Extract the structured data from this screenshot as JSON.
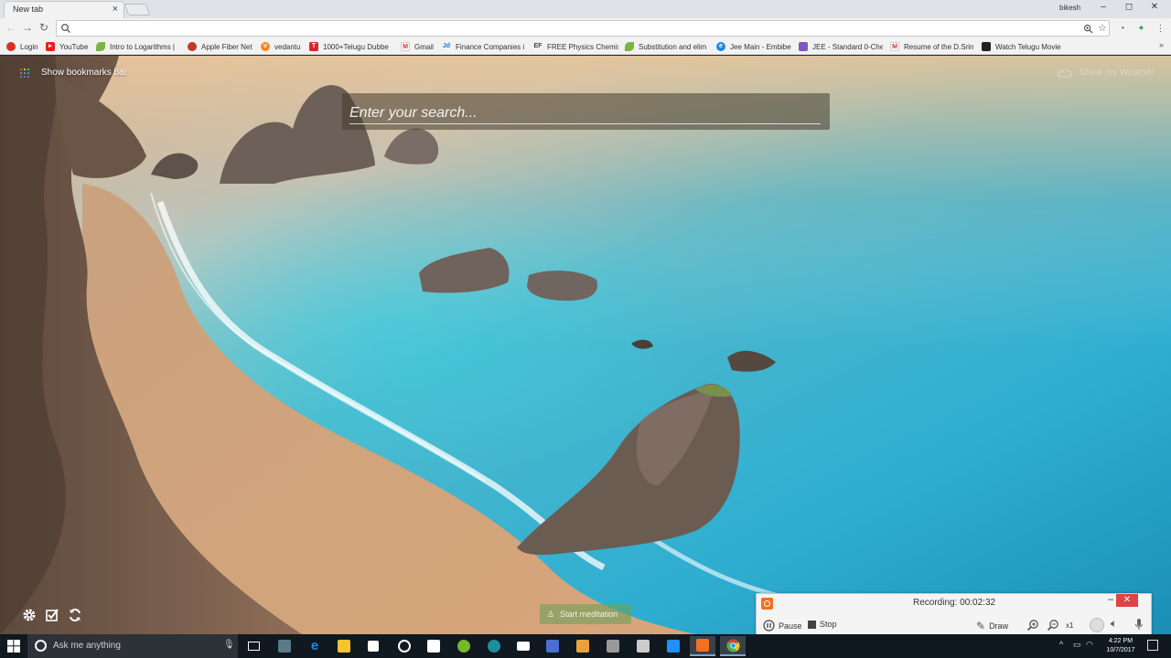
{
  "browser": {
    "tab_title": "New tab",
    "tab_close": "×",
    "profile_name": "bikesh",
    "window_controls": [
      "–",
      "◻",
      "✕"
    ],
    "address_value": "",
    "nav_icons": [
      "back-icon",
      "forward-icon",
      "reload-icon"
    ],
    "right_icons": [
      "zoom-icon",
      "star-icon",
      "extension-icon",
      "extension-icon",
      "menu-icon"
    ]
  },
  "bookmarks": {
    "items": [
      {
        "label": "Login",
        "icon": "login-icon",
        "color": "#d93025"
      },
      {
        "label": "YouTube",
        "icon": "youtube-icon",
        "color": "#e62117"
      },
      {
        "label": "Intro to Logarithms |",
        "icon": "leaf-icon",
        "color": "#7cb342"
      },
      {
        "label": "Apple Fiber Net",
        "icon": "apple-icon",
        "color": "#c0392b"
      },
      {
        "label": "vedantu",
        "icon": "vedantu-icon",
        "color": "#f08a24"
      },
      {
        "label": "1000+Telugu Dubbe",
        "icon": "telugu-icon",
        "color": "#d62828"
      },
      {
        "label": "Gmail",
        "icon": "gmail-icon",
        "color": "#d93025"
      },
      {
        "label": "Finance Companies i",
        "icon": "jd-icon",
        "color": "#1a73e8"
      },
      {
        "label": "FREE Physics Chemist",
        "icon": "ef-icon",
        "color": "#444444"
      },
      {
        "label": "Substitution and elim",
        "icon": "leaf-icon",
        "color": "#7cb342"
      },
      {
        "label": "Jee Main - Embibe",
        "icon": "embibe-icon",
        "color": "#1e88e5"
      },
      {
        "label": "JEE - Standard 0-Che",
        "icon": "book-icon",
        "color": "#7e57c2"
      },
      {
        "label": "Resume of the D.Srin",
        "icon": "gmail-icon",
        "color": "#d93025"
      },
      {
        "label": "Watch Telugu Movie",
        "icon": "movie-icon",
        "color": "#222222"
      }
    ],
    "more": "»"
  },
  "page": {
    "show_bookmarks_bar": "Show bookmarks bar",
    "show_weather": "Show my Weather",
    "search_placeholder": "Enter your search...",
    "start_meditation": "Start meditation",
    "bottom_icons": [
      "gear-icon",
      "checkbox-icon",
      "refresh-icon"
    ]
  },
  "recorder": {
    "status_label": "Recording:",
    "time": "00:02:32",
    "pause": "Pause",
    "stop": "Stop",
    "draw": "Draw",
    "zoom_level": "x1",
    "minimize": "–",
    "close": "✕",
    "accent": "#f37021"
  },
  "taskbar": {
    "search_placeholder": "Ask me anything",
    "apps": [
      {
        "icon": "task-view-icon",
        "color": "#ffffff"
      },
      {
        "icon": "unknown-app-icon",
        "color": "#5a7a8a"
      },
      {
        "icon": "edge-icon",
        "color": "#1e88e5"
      },
      {
        "icon": "file-explorer-icon",
        "color": "#f4c430"
      },
      {
        "icon": "store-icon",
        "color": "#ffffff"
      },
      {
        "icon": "media-icon",
        "color": "#ffffff"
      },
      {
        "icon": "photos-icon",
        "color": "#ffffff"
      },
      {
        "icon": "utorrent-icon",
        "color": "#76b82a"
      },
      {
        "icon": "app-icon",
        "color": "#1a8f9c"
      },
      {
        "icon": "mail-icon",
        "color": "#ffffff"
      },
      {
        "icon": "notes-icon",
        "color": "#4b6fd1"
      },
      {
        "icon": "paint-icon",
        "color": "#e8a33c"
      },
      {
        "icon": "app-icon",
        "color": "#999999"
      },
      {
        "icon": "app-icon",
        "color": "#cccccc"
      },
      {
        "icon": "sync-icon",
        "color": "#1e90ff"
      },
      {
        "icon": "recorder-icon",
        "color": "#f37021"
      },
      {
        "icon": "chrome-icon",
        "color": "#4caf50"
      }
    ],
    "time": "4:22 PM",
    "date": "10/7/2017"
  }
}
